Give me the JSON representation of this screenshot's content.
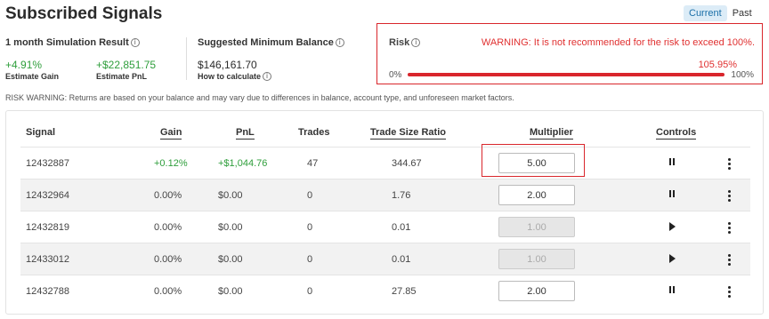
{
  "title": "Subscribed Signals",
  "view_toggle": {
    "current": "Current",
    "past": "Past"
  },
  "simulation": {
    "label": "1 month Simulation Result",
    "gain_value": "+4.91%",
    "gain_label": "Estimate Gain",
    "pnl_value": "+$22,851.75",
    "pnl_label": "Estimate PnL"
  },
  "min_balance": {
    "label": "Suggested Minimum Balance",
    "value": "$146,161.70",
    "how_label": "How to calculate"
  },
  "risk": {
    "label": "Risk",
    "warning": "WARNING: It is not recommended for the risk to exceed 100%.",
    "percent": "105.95%",
    "fill_fraction": 1.0,
    "min_label": "0%",
    "max_label": "100%"
  },
  "risk_note": "RISK WARNING: Returns are based on your balance and may vary due to differences in balance, account type, and unforeseen market factors.",
  "colors": {
    "accent_red": "#d9262c",
    "positive_green": "#2e9e3b",
    "toggle_active": "#1a6fa8"
  },
  "table": {
    "headers": {
      "signal": "Signal",
      "gain": "Gain",
      "pnl": "PnL",
      "trades": "Trades",
      "ratio": "Trade Size Ratio",
      "multiplier": "Multiplier",
      "controls": "Controls"
    },
    "rows": [
      {
        "signal": "12432887",
        "gain": "+0.12%",
        "pnl": "+$1,044.76",
        "trades": "47",
        "ratio": "344.67",
        "multiplier": "5.00",
        "control": "pause-icon"
      },
      {
        "signal": "12432964",
        "gain": "0.00%",
        "pnl": "$0.00",
        "trades": "0",
        "ratio": "1.76",
        "multiplier": "2.00",
        "control": "pause-icon"
      },
      {
        "signal": "12432819",
        "gain": "0.00%",
        "pnl": "$0.00",
        "trades": "0",
        "ratio": "0.01",
        "multiplier": "1.00",
        "control": "play-icon"
      },
      {
        "signal": "12433012",
        "gain": "0.00%",
        "pnl": "$0.00",
        "trades": "0",
        "ratio": "0.01",
        "multiplier": "1.00",
        "control": "play-icon"
      },
      {
        "signal": "12432788",
        "gain": "0.00%",
        "pnl": "$0.00",
        "trades": "0",
        "ratio": "27.85",
        "multiplier": "2.00",
        "control": "pause-icon"
      }
    ]
  }
}
